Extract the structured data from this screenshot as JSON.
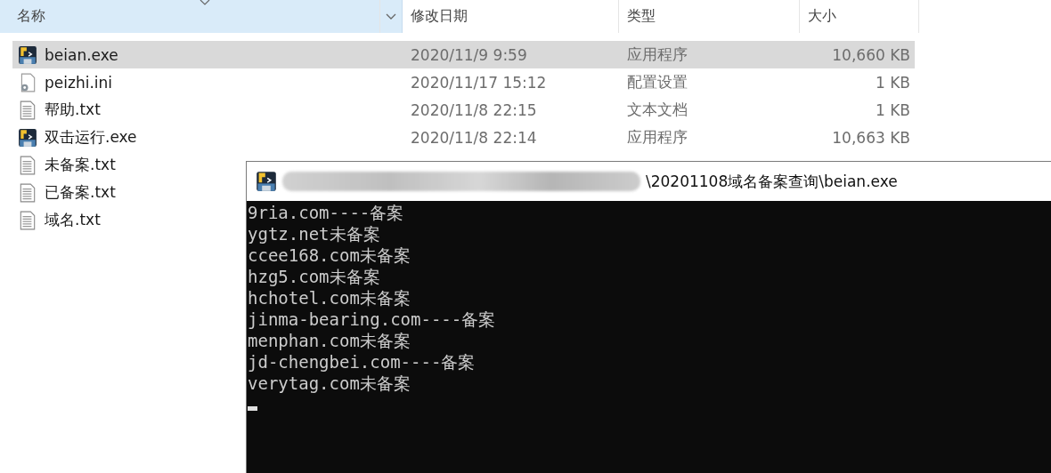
{
  "explorer": {
    "columns": [
      {
        "label": "名称",
        "selected": true
      },
      {
        "label": "修改日期",
        "selected": false
      },
      {
        "label": "类型",
        "selected": false
      },
      {
        "label": "大小",
        "selected": false
      }
    ],
    "rows": [
      {
        "kind": "exe",
        "name": "beian.exe",
        "date": "2020/11/9 9:59",
        "type": "应用程序",
        "size": "10,660 KB",
        "selected": true
      },
      {
        "kind": "ini",
        "name": "peizhi.ini",
        "date": "2020/11/17 15:12",
        "type": "配置设置",
        "size": "1 KB",
        "selected": false
      },
      {
        "kind": "txt",
        "name": "帮助.txt",
        "date": "2020/11/8 22:15",
        "type": "文本文档",
        "size": "1 KB",
        "selected": false
      },
      {
        "kind": "exe",
        "name": "双击运行.exe",
        "date": "2020/11/8 22:14",
        "type": "应用程序",
        "size": "10,663 KB",
        "selected": false
      },
      {
        "kind": "txt",
        "name": "未备案.txt",
        "selected": false
      },
      {
        "kind": "txt",
        "name": "已备案.txt",
        "selected": false
      },
      {
        "kind": "txt",
        "name": "域名.txt",
        "selected": false
      }
    ]
  },
  "console": {
    "title": "\\20201108域名备案查询\\beian.exe",
    "lines": [
      "9ria.com----备案",
      "ygtz.net未备案",
      "ccee168.com未备案",
      "hzg5.com未备案",
      "hchotel.com未备案",
      "jinma-bearing.com----备案",
      "menphan.com未备案",
      "jd-chengbei.com----备案",
      "verytag.com未备案"
    ]
  }
}
